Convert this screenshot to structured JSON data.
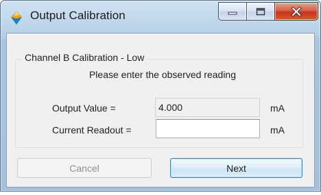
{
  "window": {
    "title": "Output Calibration",
    "icon": "app-icon",
    "controls": [
      "minimize-icon",
      "maximize-icon",
      "close-icon"
    ]
  },
  "group": {
    "title": "Channel B Calibration - Low",
    "prompt": "Please enter the observed reading"
  },
  "fields": {
    "output_value": {
      "label": "Output Value =",
      "value": "4.000",
      "unit": "mA"
    },
    "current_readout": {
      "label": "Current Readout =",
      "value": "",
      "unit": "mA"
    }
  },
  "buttons": {
    "cancel_label": "Cancel",
    "next_label": "Next"
  },
  "colors": {
    "frame": "#b9d2e8",
    "close_button": "#c3361a",
    "default_button_border": "#3c7fb1"
  }
}
